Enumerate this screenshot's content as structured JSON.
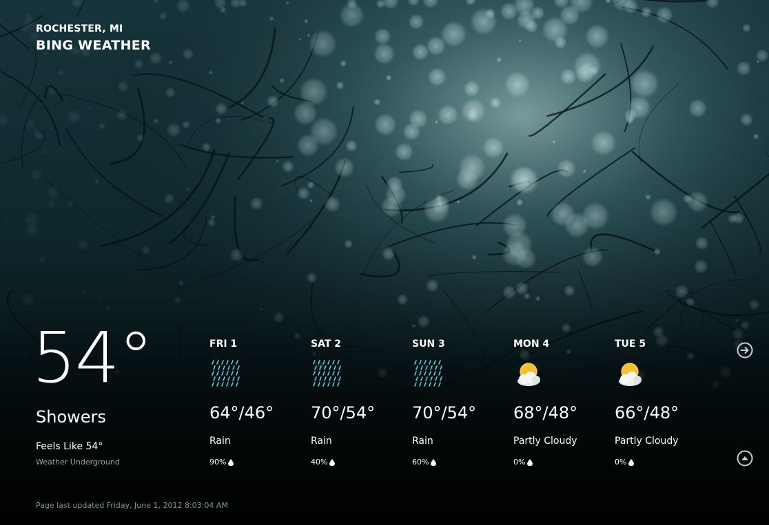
{
  "location": "ROCHESTER, MI",
  "app_title": "BING WEATHER",
  "current": {
    "temperature": "54°",
    "condition": "Showers",
    "feels_like": "Feels Like 54°",
    "provider": "Weather Underground"
  },
  "forecast": [
    {
      "day": "FRI 1",
      "icon": "rain-icon",
      "temps": "64°/46°",
      "condition": "Rain",
      "precip": "90%"
    },
    {
      "day": "SAT 2",
      "icon": "rain-icon",
      "temps": "70°/54°",
      "condition": "Rain",
      "precip": "40%"
    },
    {
      "day": "SUN 3",
      "icon": "rain-icon",
      "temps": "70°/54°",
      "condition": "Rain",
      "precip": "60%"
    },
    {
      "day": "MON 4",
      "icon": "partly-cloudy-icon",
      "temps": "68°/48°",
      "condition": "Partly Cloudy",
      "precip": "0%"
    },
    {
      "day": "TUE 5",
      "icon": "partly-cloudy-icon",
      "temps": "66°/48°",
      "condition": "Partly Cloudy",
      "precip": "0%"
    }
  ],
  "navigation": {
    "next_icon": "arrow-right-circle-icon",
    "up_icon": "arrow-up-circle-icon"
  },
  "last_updated": "Page last updated Friday, June 1, 2012 8:03:04 AM",
  "colors": {
    "text": "#ffffff",
    "secondary_text": "#9aa3a6",
    "rain_icon": "#5fd0e0",
    "sun": "#f5c12e"
  }
}
